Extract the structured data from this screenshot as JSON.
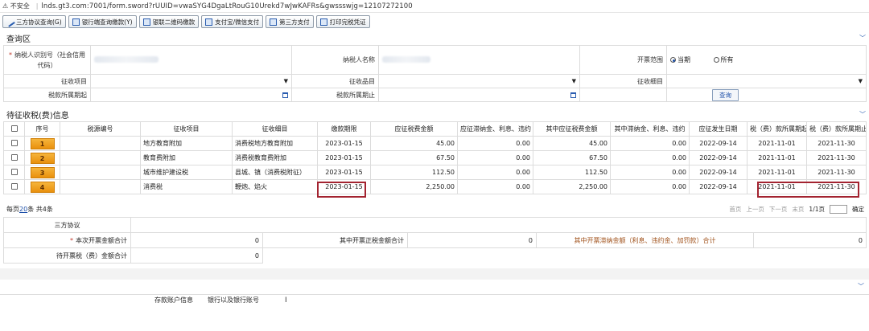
{
  "browser": {
    "insecure_label": "⚠ 不安全",
    "url": "lnds.gt3.com:7001/form.sword?rUUID=vwaSYG4DgaLtRouG10Urekd7wJwKAFRs&gwssswjg=12107272100"
  },
  "toolbar": {
    "buttons": [
      "三方协议查询(G)",
      "银行端查询缴款(Y)",
      "银联二维码缴款",
      "支付宝/微信支付",
      "第三方支付",
      "打印完税凭证"
    ]
  },
  "query": {
    "section_title": "查询区",
    "taxpayer_id_label_1": "纳税人识别号（社会信用",
    "taxpayer_id_label_2": "代码）",
    "taxpayer_name_label": "纳税人名称",
    "issue_range_label": "开票范围",
    "range_options": [
      "当期",
      "所有"
    ],
    "levy_item_label": "征收项目",
    "levy_category_label": "征收品目",
    "levy_subitem_label": "征收细目",
    "period_start_label": "税款所属期起",
    "period_end_label": "税款所属期止",
    "query_button": "查询"
  },
  "pending": {
    "section_title": "待征收税(费)信息",
    "headers": [
      "序号",
      "税源编号",
      "征收项目",
      "征收细目",
      "缴款期限",
      "应征税费金额",
      "应征滞纳金、利息、违约",
      "其中应征税费金额",
      "其中滞纳金、利息、违约",
      "应征发生日期",
      "税（费）款所属期起",
      "税（费）款所属期止"
    ],
    "rows": [
      {
        "seq": "1",
        "source_no": "",
        "item": "地方教育附加",
        "subitem": "消费税地方教育附加",
        "deadline": "2023-01-15",
        "amount": "45.00",
        "late_fee": "0.00",
        "tax_amount": "45.00",
        "late_sub": "0.00",
        "occur_date": "2022-09-14",
        "period_start": "2021-11-01",
        "period_end": "2021-11-30"
      },
      {
        "seq": "2",
        "source_no": "",
        "item": "教育费附加",
        "subitem": "消费税教育费附加",
        "deadline": "2023-01-15",
        "amount": "67.50",
        "late_fee": "0.00",
        "tax_amount": "67.50",
        "late_sub": "0.00",
        "occur_date": "2022-09-14",
        "period_start": "2021-11-01",
        "period_end": "2021-11-30"
      },
      {
        "seq": "3",
        "source_no": "",
        "item": "城市维护建设税",
        "subitem": "县城、镇（消费税附征）",
        "deadline": "2023-01-15",
        "amount": "112.50",
        "late_fee": "0.00",
        "tax_amount": "112.50",
        "late_sub": "0.00",
        "occur_date": "2022-09-14",
        "period_start": "2021-11-01",
        "period_end": "2021-11-30"
      },
      {
        "seq": "4",
        "source_no": "",
        "item": "消费税",
        "subitem": "鞭炮、焰火",
        "deadline": "2023-01-15",
        "amount": "2,250.00",
        "late_fee": "0.00",
        "tax_amount": "2,250.00",
        "late_sub": "0.00",
        "occur_date": "2022-09-14",
        "period_start": "2021-11-01",
        "period_end": "2021-11-30"
      }
    ]
  },
  "pager": {
    "per_page_prefix": "每页",
    "per_page": "20",
    "per_page_suffix": "条 共4条",
    "first": "首页",
    "prev": "上一页",
    "next": "下一页",
    "last": "末页",
    "page_info": "1/1页",
    "go": "确定"
  },
  "summary": {
    "tripartite_label": "三方协议",
    "total_label": "本次开票金额合计",
    "total_value": "0",
    "positive_tax_label": "其中开票正税金额合计",
    "positive_tax_value": "0",
    "late_label": "其中开票滞纳金额（利息、违约金、加罚款）合计",
    "late_value": "0",
    "pending_label": "待开票税（费）金额合计",
    "pending_value": "0"
  },
  "bottom": {
    "deposit_label": "存款账户信息",
    "bank_label": "银行以及银行账号"
  },
  "colors": {
    "seq_badge": "#e9900d",
    "highlight": "#a32330",
    "link": "#1d4fa8"
  }
}
